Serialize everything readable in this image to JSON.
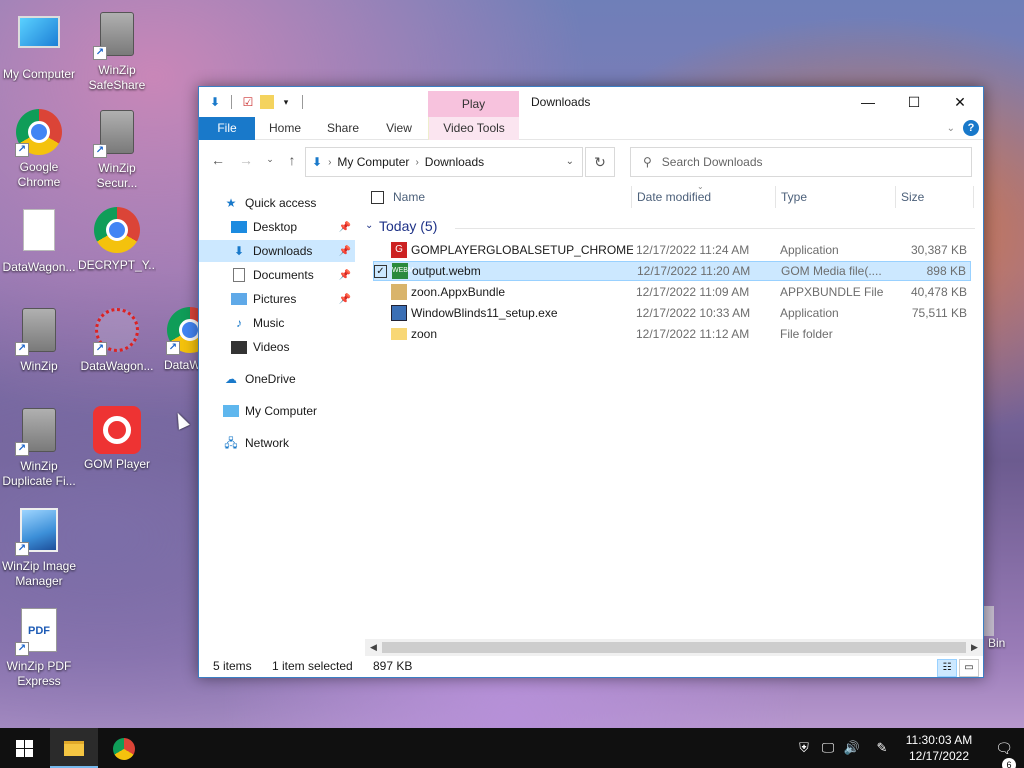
{
  "desktop": {
    "icons": [
      {
        "label": "My Computer",
        "icon": "my-computer-icon"
      },
      {
        "label": "WinZip SafeShare",
        "icon": "winzip-safeshare-icon"
      },
      {
        "label": "Google Chrome",
        "icon": "chrome-icon"
      },
      {
        "label": "WinZip Secur...",
        "icon": "winzip-secure-icon"
      },
      {
        "label": "DataWagon...",
        "icon": "document-icon"
      },
      {
        "label": "DECRYPT_Y...",
        "icon": "chrome-icon"
      },
      {
        "label": "WinZip",
        "icon": "winzip-icon"
      },
      {
        "label": "DataWagon...",
        "icon": "datawagon-icon"
      },
      {
        "label": "DataW",
        "icon": "chrome-icon"
      },
      {
        "label": "WinZip Duplicate Fi...",
        "icon": "winzip-duplicate-icon"
      },
      {
        "label": "GOM Player",
        "icon": "gom-player-icon"
      },
      {
        "label": "WinZip Image Manager",
        "icon": "winzip-image-icon"
      },
      {
        "label": "WinZip PDF Express",
        "icon": "winzip-pdf-icon"
      },
      {
        "label": "Bin",
        "icon": "recycle-bin-icon"
      }
    ],
    "pdf_icon_text": "PDF"
  },
  "window": {
    "title": "Downloads",
    "contextual_tab": "Play",
    "ribbon_tabs": [
      "File",
      "Home",
      "Share",
      "View",
      "Video Tools"
    ],
    "address": {
      "segments": [
        "My Computer",
        "Downloads"
      ]
    },
    "search_placeholder": "Search Downloads",
    "nav": [
      {
        "label": "Quick access",
        "icon": "star-icon"
      },
      {
        "label": "Desktop",
        "icon": "desktop-icon",
        "pinned": true
      },
      {
        "label": "Downloads",
        "icon": "download-icon",
        "pinned": true,
        "selected": true
      },
      {
        "label": "Documents",
        "icon": "documents-icon",
        "pinned": true
      },
      {
        "label": "Pictures",
        "icon": "pictures-icon",
        "pinned": true
      },
      {
        "label": "Music",
        "icon": "music-icon"
      },
      {
        "label": "Videos",
        "icon": "videos-icon"
      },
      {
        "label": "OneDrive",
        "icon": "cloud-icon"
      },
      {
        "label": "My Computer",
        "icon": "computer-icon"
      },
      {
        "label": "Network",
        "icon": "network-icon"
      }
    ],
    "columns": {
      "name": "Name",
      "date": "Date modified",
      "type": "Type",
      "size": "Size"
    },
    "group": "Today (5)",
    "files": [
      {
        "name": "GOMPLAYERGLOBALSETUP_CHROME...",
        "date": "12/17/2022 11:24 AM",
        "type": "Application",
        "size": "30,387 KB",
        "icon": "gom-setup-icon"
      },
      {
        "name": "output.webm",
        "date": "12/17/2022 11:20 AM",
        "type": "GOM Media file(....",
        "size": "898 KB",
        "icon": "webm-icon",
        "selected": true
      },
      {
        "name": "zoon.AppxBundle",
        "date": "12/17/2022 11:09 AM",
        "type": "APPXBUNDLE File",
        "size": "40,478 KB",
        "icon": "appx-icon"
      },
      {
        "name": "WindowBlinds11_setup.exe",
        "date": "12/17/2022 10:33 AM",
        "type": "Application",
        "size": "75,511 KB",
        "icon": "exe-icon"
      },
      {
        "name": "zoon",
        "date": "12/17/2022 11:12 AM",
        "type": "File folder",
        "size": "",
        "icon": "folder-icon"
      }
    ],
    "status": {
      "items": "5 items",
      "selected": "1 item selected",
      "size": "897 KB"
    }
  },
  "taskbar": {
    "time": "11:30:03 AM",
    "date": "12/17/2022",
    "notification_count": "6"
  }
}
